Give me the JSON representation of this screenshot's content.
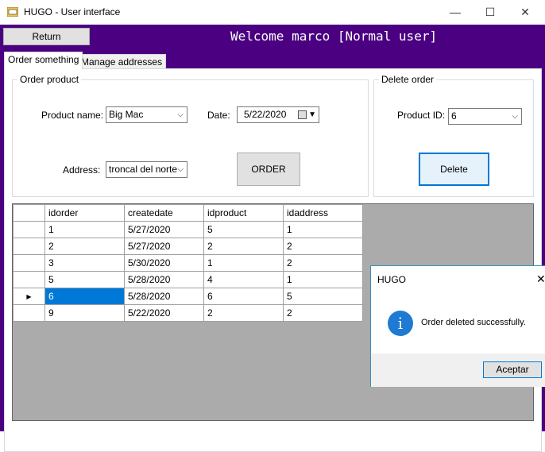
{
  "window": {
    "title": "HUGO - User interface",
    "min_glyph": "—",
    "max_glyph": "☐",
    "close_glyph": "✕"
  },
  "header": {
    "return_label": "Return",
    "welcome": "Welcome marco [Normal user]"
  },
  "tabs": [
    {
      "label": "Order something",
      "active": true
    },
    {
      "label": "Manage addresses",
      "active": false
    }
  ],
  "order_group": {
    "title": "Order product",
    "product_label": "Product name:",
    "product_value": "Big Mac",
    "date_label": "Date:",
    "date_value": "5/22/2020",
    "address_label": "Address:",
    "address_value": "troncal del norte",
    "order_button": "ORDER"
  },
  "delete_group": {
    "title": "Delete order",
    "product_id_label": "Product ID:",
    "product_id_value": "6",
    "delete_button": "Delete"
  },
  "grid": {
    "columns": [
      "idorder",
      "createdate",
      "idproduct",
      "idaddress"
    ],
    "rows": [
      {
        "idorder": "1",
        "createdate": "5/27/2020",
        "idproduct": "5",
        "idaddress": "1"
      },
      {
        "idorder": "2",
        "createdate": "5/27/2020",
        "idproduct": "2",
        "idaddress": "2"
      },
      {
        "idorder": "3",
        "createdate": "5/30/2020",
        "idproduct": "1",
        "idaddress": "2"
      },
      {
        "idorder": "5",
        "createdate": "5/28/2020",
        "idproduct": "4",
        "idaddress": "1"
      },
      {
        "idorder": "6",
        "createdate": "5/28/2020",
        "idproduct": "6",
        "idaddress": "5"
      },
      {
        "idorder": "9",
        "createdate": "5/22/2020",
        "idproduct": "2",
        "idaddress": "2"
      }
    ],
    "current_row_marker": "▶"
  },
  "dialog": {
    "title": "HUGO",
    "message": "Order deleted successfully.",
    "ok_button": "Aceptar",
    "icon_glyph": "i"
  },
  "colors": {
    "frame": "#4b0082",
    "selection": "#0078d7",
    "grid_background": "#ababab"
  },
  "icons": [
    "app-icon",
    "info-icon",
    "calendar-icon",
    "dropdown-arrow-icon",
    "close-icon"
  ]
}
